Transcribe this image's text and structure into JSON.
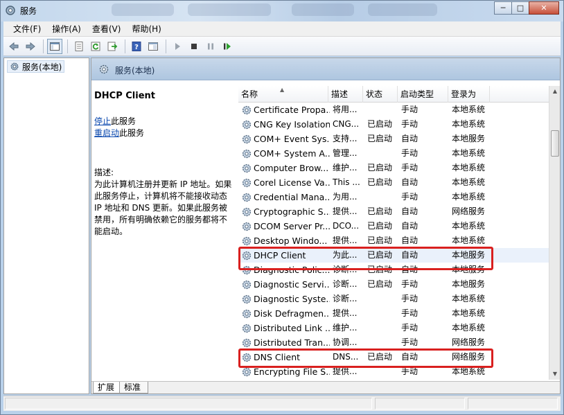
{
  "window": {
    "title": "服务"
  },
  "menu": [
    {
      "label": "文件(F)"
    },
    {
      "label": "操作(A)"
    },
    {
      "label": "查看(V)"
    },
    {
      "label": "帮助(H)"
    }
  ],
  "tree": {
    "root_label": "服务(本地)"
  },
  "main": {
    "header_title": "服务(本地)",
    "tabs": [
      {
        "label": "扩展"
      },
      {
        "label": "标准"
      }
    ]
  },
  "detail": {
    "service_name": "DHCP Client",
    "stop_link": "停止",
    "stop_suffix": "此服务",
    "restart_link": "重启动",
    "restart_suffix": "此服务",
    "desc_label": "描述:",
    "desc_text": "为此计算机注册并更新 IP 地址。如果此服务停止，计算机将不能接收动态 IP 地址和 DNS 更新。如果此服务被禁用，所有明确依赖它的服务都将不能启动。"
  },
  "columns": {
    "name": "名称",
    "desc": "描述",
    "status": "状态",
    "startup": "启动类型",
    "logon": "登录为"
  },
  "services": [
    {
      "name": "Certificate Propa...",
      "desc": "将用...",
      "status": "",
      "startup": "手动",
      "logon": "本地系统"
    },
    {
      "name": "CNG Key Isolation",
      "desc": "CNG...",
      "status": "已启动",
      "startup": "手动",
      "logon": "本地系统"
    },
    {
      "name": "COM+ Event Sys...",
      "desc": "支持...",
      "status": "已启动",
      "startup": "自动",
      "logon": "本地服务"
    },
    {
      "name": "COM+ System A...",
      "desc": "管理...",
      "status": "",
      "startup": "手动",
      "logon": "本地系统"
    },
    {
      "name": "Computer Brow...",
      "desc": "维护...",
      "status": "已启动",
      "startup": "手动",
      "logon": "本地系统"
    },
    {
      "name": "Corel License Va...",
      "desc": "This ...",
      "status": "已启动",
      "startup": "自动",
      "logon": "本地系统"
    },
    {
      "name": "Credential Mana...",
      "desc": "为用...",
      "status": "",
      "startup": "手动",
      "logon": "本地系统"
    },
    {
      "name": "Cryptographic S...",
      "desc": "提供...",
      "status": "已启动",
      "startup": "自动",
      "logon": "网络服务"
    },
    {
      "name": "DCOM Server Pr...",
      "desc": "DCO...",
      "status": "已启动",
      "startup": "自动",
      "logon": "本地系统"
    },
    {
      "name": "Desktop Windo...",
      "desc": "提供...",
      "status": "已启动",
      "startup": "自动",
      "logon": "本地系统"
    },
    {
      "name": "DHCP Client",
      "desc": "为此...",
      "status": "已启动",
      "startup": "自动",
      "logon": "本地服务"
    },
    {
      "name": "Diagnostic Polic...",
      "desc": "诊断...",
      "status": "已启动",
      "startup": "自动",
      "logon": "本地服务"
    },
    {
      "name": "Diagnostic Servi...",
      "desc": "诊断...",
      "status": "已启动",
      "startup": "手动",
      "logon": "本地服务"
    },
    {
      "name": "Diagnostic Syste...",
      "desc": "诊断...",
      "status": "",
      "startup": "手动",
      "logon": "本地系统"
    },
    {
      "name": "Disk Defragmen...",
      "desc": "提供...",
      "status": "",
      "startup": "手动",
      "logon": "本地系统"
    },
    {
      "name": "Distributed Link ...",
      "desc": "维护...",
      "status": "",
      "startup": "手动",
      "logon": "本地系统"
    },
    {
      "name": "Distributed Tran...",
      "desc": "协调...",
      "status": "",
      "startup": "手动",
      "logon": "网络服务"
    },
    {
      "name": "DNS Client",
      "desc": "DNS...",
      "status": "已启动",
      "startup": "自动",
      "logon": "网络服务"
    },
    {
      "name": "Encrypting File S...",
      "desc": "提供...",
      "status": "",
      "startup": "手动",
      "logon": "本地系统"
    }
  ],
  "highlight_color": "#d9201f"
}
